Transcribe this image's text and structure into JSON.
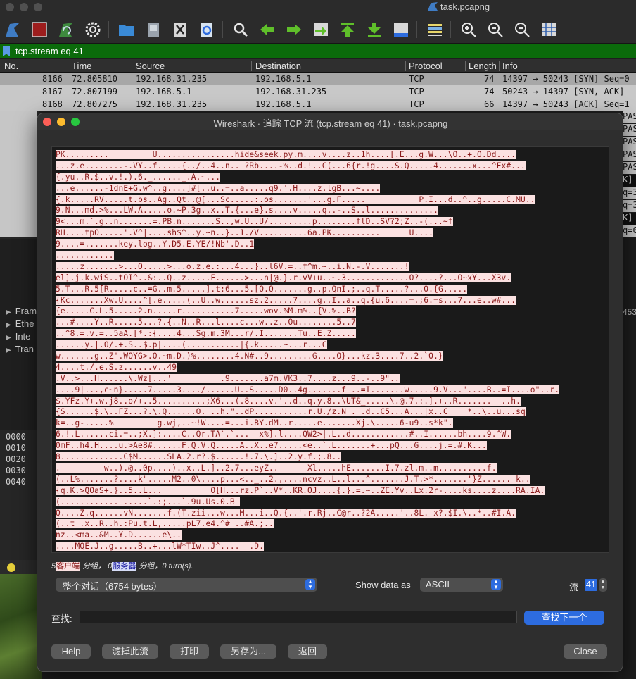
{
  "window": {
    "title": "task.pcapng"
  },
  "filter": {
    "value": "tcp.stream eq 41"
  },
  "packet_list": {
    "columns": [
      "No.",
      "Time",
      "Source",
      "Destination",
      "Protocol",
      "Length",
      "Info"
    ],
    "rows": [
      {
        "no": "8166",
        "time": "72.805810",
        "src": "192.168.31.235",
        "dst": "192.168.5.1",
        "proto": "TCP",
        "len": "74",
        "info": "14397 → 50243 [SYN] Seq=0"
      },
      {
        "no": "8167",
        "time": "72.807199",
        "src": "192.168.5.1",
        "dst": "192.168.31.235",
        "proto": "TCP",
        "len": "74",
        "info": "50243 → 14397 [SYN, ACK]"
      },
      {
        "no": "8168",
        "time": "72.807275",
        "src": "192.168.31.235",
        "dst": "192.168.5.1",
        "proto": "TCP",
        "len": "66",
        "info": "14397 → 50243 [ACK] Seq=1"
      }
    ],
    "right_fragments": [
      "PAS",
      "PAS",
      "PAS",
      "PAS",
      "PAS",
      "K]",
      "q=3",
      "q=3",
      "K]",
      "q=0"
    ]
  },
  "details": {
    "items": [
      "Fram",
      "Ethe",
      "Inte",
      "Tran"
    ],
    "fragment": "453"
  },
  "hex": {
    "offsets": [
      "0000",
      "0010",
      "0020",
      "0030",
      "0040"
    ]
  },
  "dialog": {
    "title": "Wireshark · 追踪 TCP 流 (tcp.stream eq 41) · task.pcapng",
    "stream_lines": [
      "PK.........         U................hide&seek.py.m....v....z..1h....[.E...g.W...\\O..+.O.Dd....",
      "...z.e........-.VY..f.....{../..4..n.._?Rb....-%..d.!..C(...6{r.!g....S.Q.....4.......x...^Fx#...",
      "{.yu..R.$..v.!.).6._......_.A.~...",
      "...e......-1dnE+G.w^..g....]#[..u..=..a.....q9.'.H....z.lgB...~....",
      "{.k.....RV.....t.bs..Ag..Qt..@[...Sc.....:.os.......'...g.F.....           P.I...d..^..g.....C.MU..",
      "9.N...md.>%...LW.A.....o.~P.3g..x..T.{...e}.s....v.....q..-..S..l..............",
      "9<...m.`.g..n.......=.PB.n.......S..,w.U..U/.........p........flD..SV?2;Z..-(...~f",
      "RH....tpO.....'.V^|....sh$^..y.~n..}..1./V..........6a.PK..........      U....",
      "9....=.......key.log..Y.D5.E.YE/!Nb'.D..1",
      "............",
      ".....z.......>...O.....>...o.z.e.:...4...}..l6V.=..f^m.~..i.N.-.V.......!",
      "el].j.k.wiS..tOI^..&:..Q..z.....F......>...n|@.}.r.vV+u..~.3.............O?....?...O~xY...X3v.",
      "5.T...R.5[R.....c..=G..m.5.....].t:6...5.[O.Q.......g..p.QnI.;..q.T.....?...O.{G.....",
      "{Kc.......Xw.U....^[.e.....(..U..w......sz.2.....7....g..I..a..q.{u.6....=.;6.=s...7...e..w#...",
      "{e.....C.L.5.....2.n.....r...........7.....wov.%M.m%..{V.%..B?",
      "...#....Y..R.....5...?.{..N..R...l....c...w..z..Ou........5..7",
      "..^8.=.v.=..5aA.[*.:{....4...Sg.m.3M...r/.I.......Tu..E.Z.....",
      "......y.|.O/.+.S..$.p|....(...........|{.k.....~...r...C",
      "w.......g..Z'.WOYG>.O.~m.D.)%........4.N#..9.........G....O}...kz.3....7..2.`O.}",
      "4....t./.e.S.z......v..49",
      ".V..>...H......\\.Wz[...'          .9.......a7m.VK3..7....z...9..-..9\"..",
      "....9|...,c~n}.....7.....3..../......U..S.....D0..4g.......f ..=I.......w.....9.V...\"....B..=I....o\"..r.",
      "$.YFz.Y+.w.j8..o/+..5..........;X6...(.8....v.'..d..q.y.8..\\UT&_.....\\.@.7.:.].+..R.......  ..h.",
      "{S......$.\\..FZ...?.\\.Q......O. ..h.\"..dP...........r.U./z.N_. .d..C5...A...|x..C    *..\\..u...sq",
      "k=..g-.....%         g.wj,..~!W....=...i.BY.dM..r.....e.......Xj.\\.....6-u9..s*k\".",
      "6.!.L......ci.=..;X.]:....C..Qr.TA`.`...  x%].l....QW2>|.L..d............#..I......bh....9.^W.",
      "0mF..h4.H....u.>Ae8#......F.Q.V.Q.....A..X..e7.....<e..`.L.......+...pQ...G....j.=.#.K...",
      "8.............C$M......SLA.2.r?.$......!.7.\\.]..2.y.f.;.8..",
      ".         w..).@..0p....)..x..L.]..2.7...eyZ..      Xl.....hE.......I.7.zl.m..m..........f.",
      "(..L%.......?....k\".....M2..0\\....p...<.._..2.,....ncvz..L..l...^.......J.T.>*.......'}Z...... k..",
      "{q.K.>QOaS+.}..5..L...          O[H...rz.P`..V*..KR.OJ....{.}.=.~..ZE.Yv..Lx.2r-....ks....z....RA.IA.",
      "(............ .....`.:;...`.9u.Us.0.B_",
      "Q....Z.q......vN.......f.(T.zii...w...M...i..Q.{..'.r.Rj..C@r..?2A.....'..8L.|x?.$I.\\..*..#I.A.",
      "(..t_.x..R..h.:Pu.t.L,.....pL7.e4.^#_..#A.;..",
      "nz..<ma..&M..Y.D......e\\..",
      "....MQE.J..g.....B..+...lW*TIw..J^....  .D."
    ],
    "summary": {
      "client_count": "5",
      "client_tag": "客户端",
      "mid": "分组，",
      "server_count": "0",
      "server_tag": "服务器",
      "tail": "分组，0 turn(s)."
    },
    "conversation_select": "整个对话（6754 bytes）",
    "show_data_as_label": "Show data as",
    "show_data_as_value": "ASCII",
    "stream_label": "流",
    "stream_number": "41",
    "find_label": "查找:",
    "find_value": "",
    "find_next": "查找下一个",
    "buttons": {
      "help": "Help",
      "filter_out": "滤掉此流",
      "print": "打印",
      "save_as": "另存为...",
      "back": "返回",
      "close": "Close"
    }
  },
  "colors": {
    "client_bg": "#fbe1e1",
    "client_fg": "#8a1818",
    "filter_bar": "#0b6b0b",
    "accent": "#2d6cdf"
  }
}
